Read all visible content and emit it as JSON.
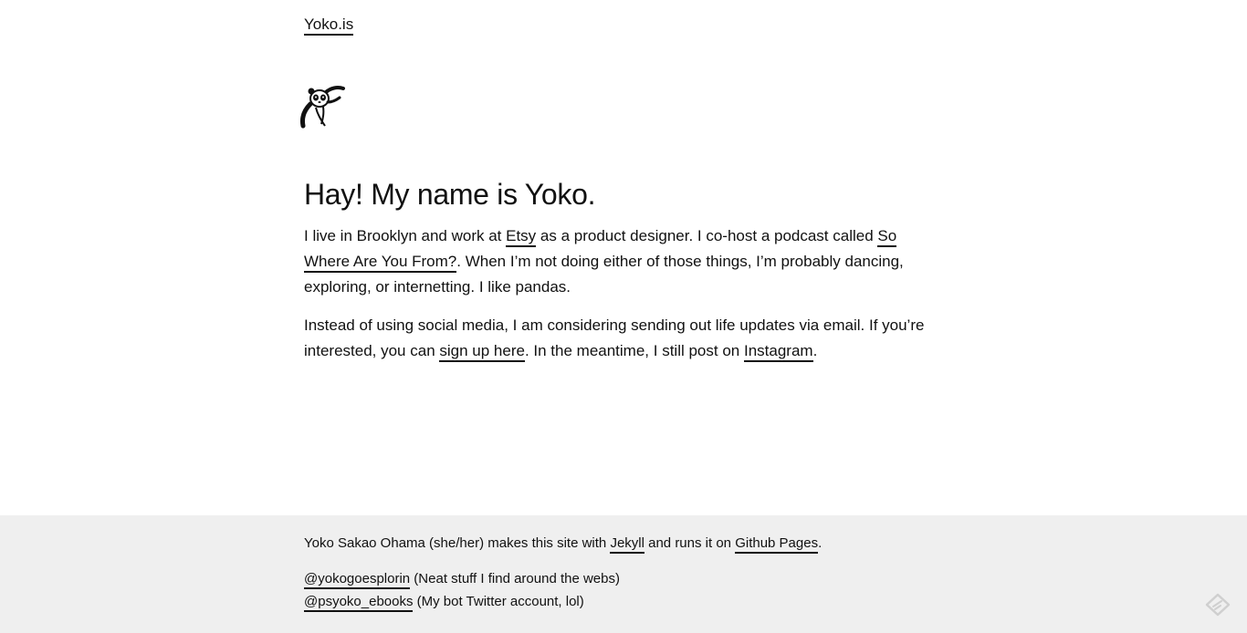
{
  "header": {
    "site_title": "Yoko.is"
  },
  "headline": "Hay! My name is Yoko.",
  "bio": {
    "p1_before_etsy": "I live in Brooklyn and work at ",
    "etsy_link": "Etsy",
    "p1_after_etsy": " as a product designer. I co-host a podcast called ",
    "podcast_link": "So Where Are You From?",
    "p1_end": ". When I’m not doing either of those things, I’m probably dancing, exploring, or internetting. I like pandas.",
    "p2_start": "Instead of using social media, I am considering sending out life updates via email. If you’re interested, you can ",
    "signup_link": "sign up here",
    "p2_middle": ". In the meantime, I still post on ",
    "instagram_link": "Instagram",
    "p2_end": "."
  },
  "footer": {
    "credits_start": "Yoko Sakao Ohama (she/her) makes this site with ",
    "jekyll_link": "Jekyll",
    "credits_middle": " and runs it on ",
    "github_link": "Github Pages",
    "credits_end": ".",
    "account1_link": "@yokogoesplorin",
    "account1_desc": " (Neat stuff I find around the webs)",
    "account2_link": "@psyoko_ebooks",
    "account2_desc": " (My bot Twitter account, lol)"
  },
  "icons": {
    "logo": "panda-icon",
    "corner": "feather-icon"
  },
  "colors": {
    "text": "#111111",
    "background": "#ffffff",
    "footer_background": "#efefef"
  }
}
